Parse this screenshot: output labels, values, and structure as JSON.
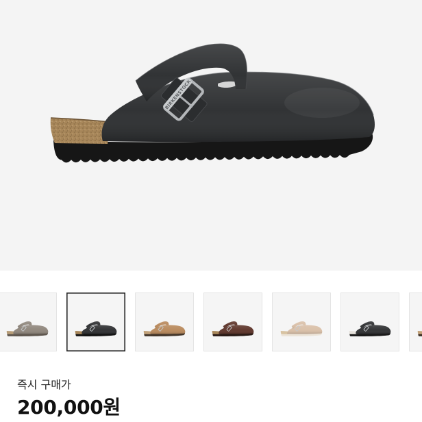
{
  "gallery": {
    "main_image": {
      "buckle_engraving": "BIRKENSTOCK",
      "upper_color": "#2b2d2f",
      "sole_color": "#161616",
      "footbed_color": "#a8875a"
    },
    "thumbnails": [
      {
        "upper_color": "#8e857b",
        "sole_color": "#5f574f",
        "footbed_color": "#b79d78",
        "selected": false
      },
      {
        "upper_color": "#2d2e30",
        "sole_color": "#141414",
        "footbed_color": "#a8875a",
        "selected": true
      },
      {
        "upper_color": "#b8885a",
        "sole_color": "#43362b",
        "footbed_color": "#c2a27a",
        "selected": false
      },
      {
        "upper_color": "#5c3328",
        "sole_color": "#2a1b16",
        "footbed_color": "#a8875a",
        "selected": false
      },
      {
        "upper_color": "#d9bfa7",
        "sole_color": "#ece4d8",
        "footbed_color": "#d8c3a2",
        "selected": false
      },
      {
        "upper_color": "#2e2f31",
        "sole_color": "#1a1a1a",
        "footbed_color": "#e6e2dc",
        "selected": false
      },
      {
        "upper_color": "#b4844f",
        "sole_color": "#3d3026",
        "footbed_color": "#c2a27a",
        "selected": false
      }
    ]
  },
  "price": {
    "label": "즉시 구매가",
    "value": "200,000원"
  }
}
